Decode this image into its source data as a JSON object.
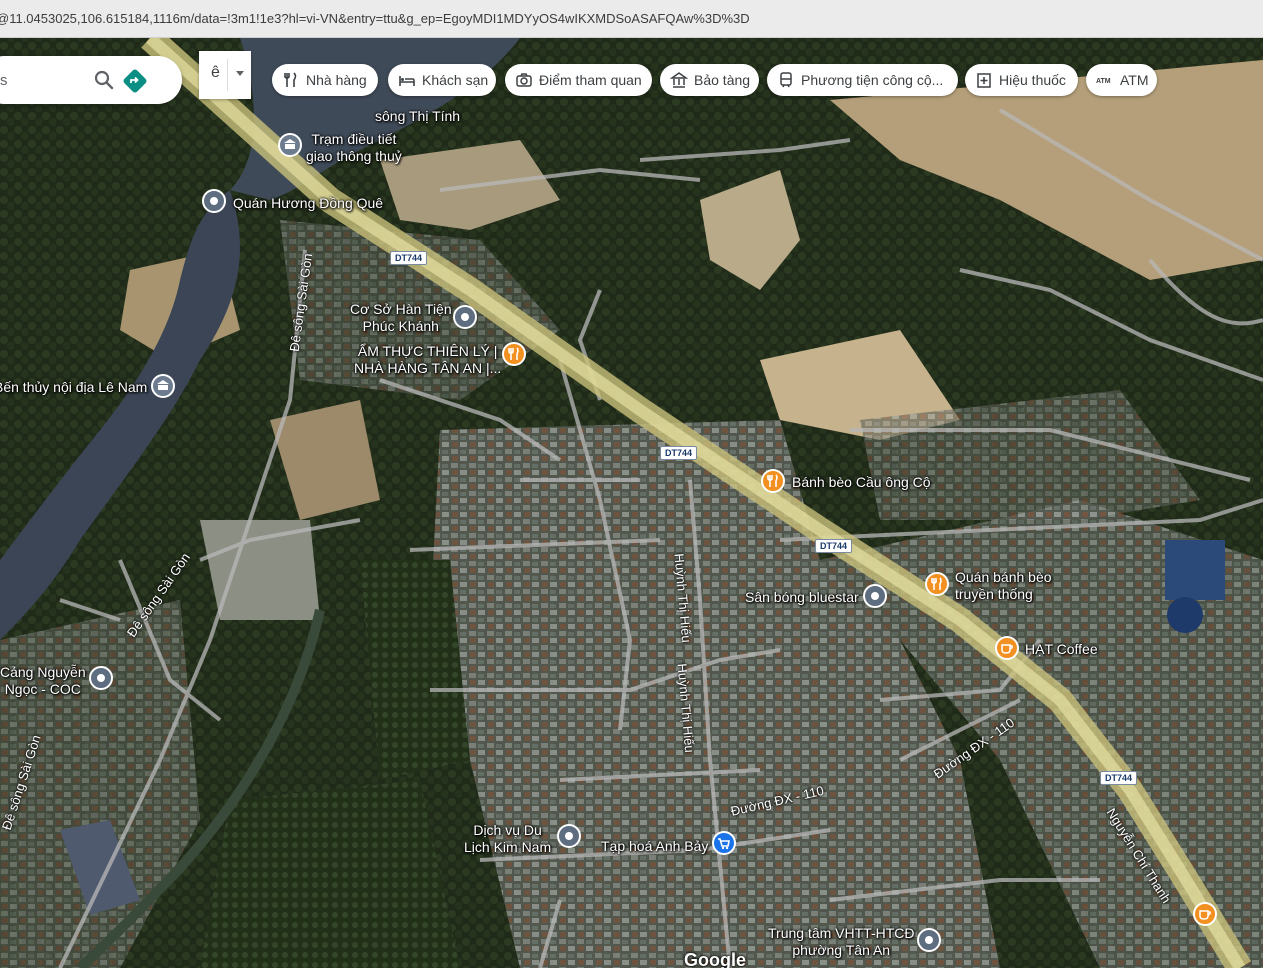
{
  "browser": {
    "url": "@11.0453025,106.615184,1116m/data=!3m1!1e3?hl=vi-VN&entry=ttu&g_ep=EgoyMDI1MDYyOS4wIKXMDSoASAFQAw%3D%3D"
  },
  "search": {
    "query_fragment": "s",
    "search_icon": "search-icon",
    "directions_icon": "directions-icon"
  },
  "language": {
    "value": "ê"
  },
  "chips": [
    {
      "label": "Nhà hàng",
      "icon": "restaurant-icon"
    },
    {
      "label": "Khách sạn",
      "icon": "hotel-icon"
    },
    {
      "label": "Điểm tham quan",
      "icon": "camera-icon"
    },
    {
      "label": "Bảo tàng",
      "icon": "museum-icon"
    },
    {
      "label": "Phương tiện công cộ...",
      "icon": "transit-icon"
    },
    {
      "label": "Hiệu thuốc",
      "icon": "pharmacy-icon"
    },
    {
      "label": "ATM",
      "icon": "atm-icon"
    }
  ],
  "places": {
    "song_thi_tinh": "sông Thị Tính",
    "tram_dieu_tiet_1": "Trạm điều tiết",
    "tram_dieu_tiet_2": "giao thông thuỷ",
    "quan_huong_dong_que": "Quán Hương Đồng Quê",
    "co_so_han_1": "Cơ Sở Hàn Tiện",
    "co_so_han_2": "Phúc Khánh",
    "am_thuc_1": "ẨM THỰC THIÊN LÝ |",
    "am_thuc_2": "NHÀ HÀNG TÂN AN |...",
    "ben_thuy": "Bến thủy nội địa Lê Nam",
    "banh_beo_cau": "Bánh bèo Cầu ông Cộ",
    "quan_banh_beo_1": "Quán bánh bèo",
    "quan_banh_beo_2": "truyền thống",
    "san_bong": "Sân bóng bluestar",
    "hat_coffee": "HẠT Coffee",
    "cang_1": "Cảng Nguyễn",
    "cang_2": "Ngọc - COC",
    "dich_vu_1": "Dịch vụ Du",
    "dich_vu_2": "Lịch Kim Nam",
    "tap_hoa": "Tạp hoá Anh Bảy",
    "trung_tam_1": "Trung tâm VHTT-HTCĐ",
    "trung_tam_2": "phường Tân An"
  },
  "roads": {
    "de_song_sai_gon": "Đê sông Sài Gòn",
    "huynh_thi_hieu": "Huỳnh Thị Hiếu",
    "duong_dx_110": "Đường ĐX - 110",
    "nguyen_chi_thanh": "Nguyễn Chí Thanh",
    "dt744": "DT744"
  },
  "attribution": {
    "logo": "Google"
  },
  "colors": {
    "restaurant_pin": "#f29022",
    "generic_pin": "#4a6ea8",
    "shopping_pin": "#1a73e8",
    "landmark_pin": "#6d7b8f"
  }
}
